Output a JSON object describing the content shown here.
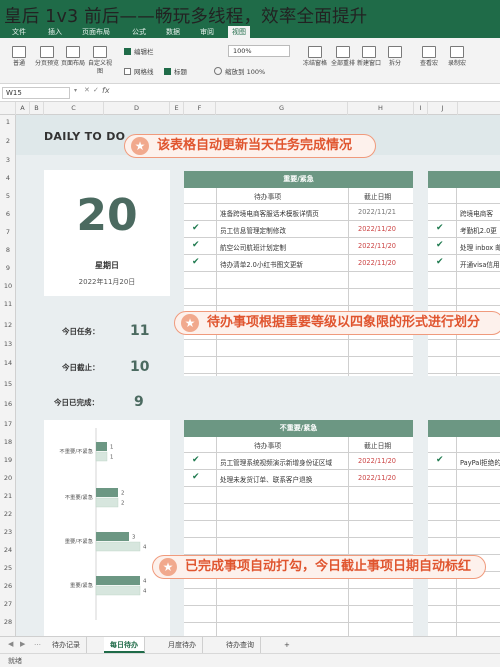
{
  "headline": "皇后 1v3 前后——畅玩多线程，效率全面提升",
  "ribbon": {
    "tabs": [
      "文件",
      "插入",
      "页面布局",
      "公式",
      "数据",
      "审阅",
      "视图"
    ],
    "active_tab": "视图",
    "buttons": [
      "普通",
      "分页预览",
      "页面布局",
      "自定义视图",
      "冻结窗格",
      "全部重排",
      "新建窗口",
      "拆分",
      "查看宏",
      "录制宏"
    ],
    "checks": [
      {
        "label": "编辑栏",
        "on": true
      },
      {
        "label": "网格线",
        "on": false
      },
      {
        "label": "标题",
        "on": true
      }
    ],
    "zoom_value": "100%",
    "zoom_fit": "缩放到 100%"
  },
  "formula_bar": {
    "cell": "W15",
    "fx": "fx"
  },
  "columns": [
    "A",
    "B",
    "C",
    "D",
    "E",
    "F",
    "G",
    "H",
    "I",
    "J"
  ],
  "rows": [
    "1",
    "2",
    "3",
    "4",
    "5",
    "6",
    "7",
    "8",
    "9",
    "10",
    "11",
    "12",
    "13",
    "14",
    "15",
    "16",
    "17",
    "18",
    "19",
    "20",
    "21",
    "22",
    "23",
    "24",
    "25",
    "26",
    "27",
    "28"
  ],
  "sheet": {
    "title": "DAILY TO DO",
    "day": "20",
    "weekday": "星期日",
    "date": "2022年11月20日",
    "stats": [
      {
        "label": "今日任务：",
        "value": "11"
      },
      {
        "label": "今日截止：",
        "value": "10"
      },
      {
        "label": "今日已完成：",
        "value": "9"
      }
    ],
    "callouts": [
      "该表格自动更新当天任务完成情况",
      "待办事项根据重要等级以四象限的形式进行划分",
      "已完成事项自动打勾，今日截止事项日期自动标红"
    ],
    "star": "★",
    "quadrant1": {
      "title": "重要/紧急",
      "col_task": "待办事项",
      "col_date": "截止日期",
      "rows": [
        {
          "check": "",
          "task": "准备跨境电商客服话术模板详情页",
          "date": "2022/11/21"
        },
        {
          "check": "✔",
          "task": "员工信息管理定制修改",
          "date": "2022/11/20"
        },
        {
          "check": "✔",
          "task": "航空公司航班计划定制",
          "date": "2022/11/20"
        },
        {
          "check": "✔",
          "task": "待办清单2.0小红书图文更新",
          "date": "2022/11/20"
        }
      ]
    },
    "quadrant2": {
      "rows": [
        {
          "check": "",
          "task": "跨境电商客"
        },
        {
          "check": "✔",
          "task": "考勤机2.0更"
        },
        {
          "check": "✔",
          "task": "处理 inbox 邮"
        },
        {
          "check": "✔",
          "task": "开通visa信用"
        }
      ]
    },
    "quadrant3": {
      "title": "不重要/紧急",
      "col_task": "待办事项",
      "col_date": "截止日期",
      "rows": [
        {
          "check": "✔",
          "task": "员工管理系统视频演示新增身份证区域",
          "date": "2022/11/20"
        },
        {
          "check": "✔",
          "task": "处理未发货订单、联系客户退换",
          "date": "2022/11/20"
        }
      ]
    },
    "quadrant4": {
      "rows": [
        {
          "check": "✔",
          "task": "PayPal拒绝的"
        }
      ]
    }
  },
  "chart_data": {
    "type": "bar",
    "orientation": "horizontal",
    "categories": [
      "不重要/不紧急",
      "不重要/紧急",
      "重要/不紧急",
      "重要/紧急"
    ],
    "series": [
      {
        "values": [
          1,
          2,
          3,
          4
        ],
        "color": "#6c9783"
      },
      {
        "values": [
          1,
          2,
          4,
          4
        ],
        "color": "#d7e6de"
      }
    ],
    "xlim": [
      0,
      4
    ]
  },
  "sheet_tabs": [
    "待办记录",
    "每日待办",
    "月度待办",
    "待办查询",
    "+"
  ],
  "active_sheet_tab": "每日待办",
  "status": "就绪"
}
